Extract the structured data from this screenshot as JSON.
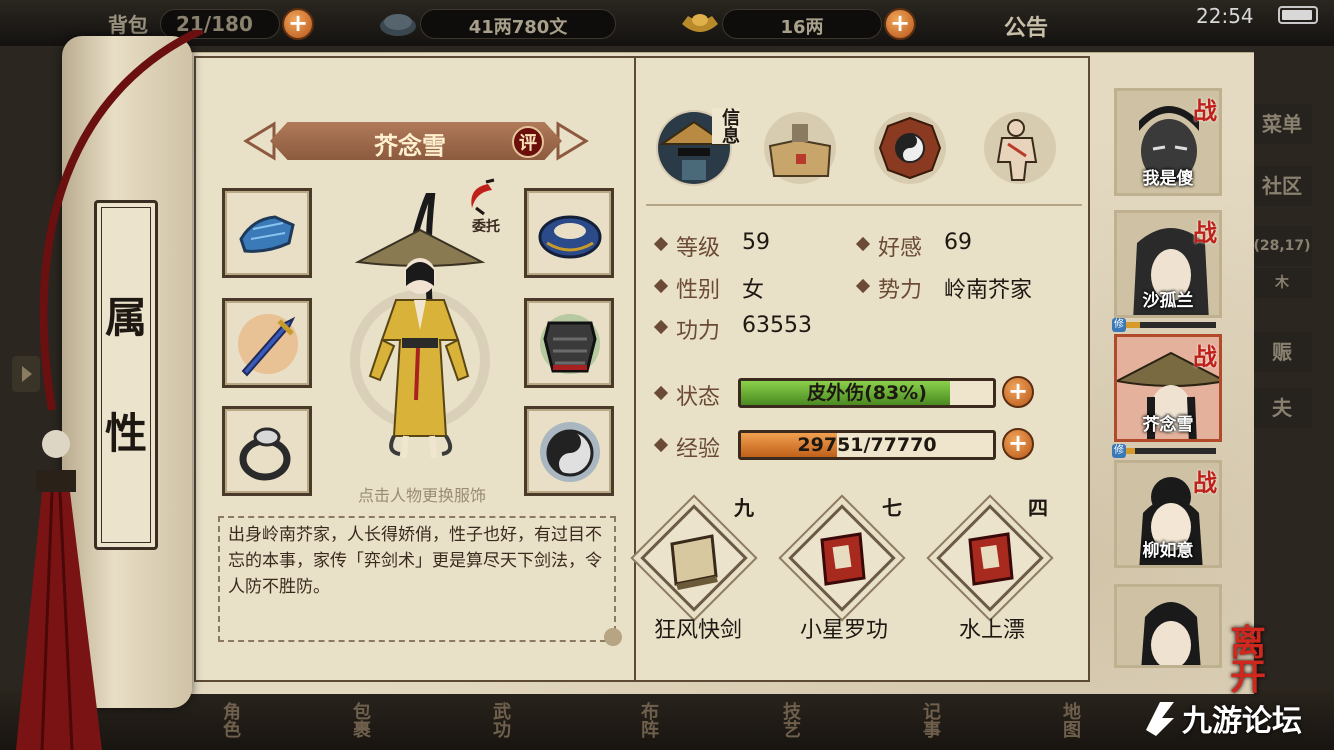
{
  "topbar": {
    "bag_label": "背包",
    "bag_count": "21/180",
    "money": "41两780文",
    "gold": "16两",
    "notice_label": "公告",
    "clock": "22:54"
  },
  "scroll": {
    "title_top": "属",
    "title_bottom": "性"
  },
  "character": {
    "name": "芥念雪",
    "review_badge": "评",
    "commission_label": "委托",
    "hint": "点击人物更换服饰",
    "description": "出身岭南芥家，人长得娇俏，性子也好，有过目不忘的本事，家传「弈剑术」更是算尽天下剑法，令人防不胜防。"
  },
  "equipment": [
    {
      "slot": "gloves",
      "icon": "gauntlet-icon"
    },
    {
      "slot": "collar",
      "icon": "collar-icon"
    },
    {
      "slot": "weapon",
      "icon": "sword-icon"
    },
    {
      "slot": "armor",
      "icon": "armor-icon"
    },
    {
      "slot": "ring",
      "icon": "ring-icon"
    },
    {
      "slot": "amulet",
      "icon": "yinyang-amulet-icon"
    }
  ],
  "tabs": {
    "info_label": "信息",
    "items": [
      "info-tab",
      "bag-tab",
      "bagua-tab",
      "meridian-tab"
    ]
  },
  "stats": {
    "level_label": "等级",
    "level": "59",
    "favor_label": "好感",
    "favor": "69",
    "gender_label": "性别",
    "gender": "女",
    "faction_label": "势力",
    "faction": "岭南芥家",
    "power_label": "功力",
    "power": "63553",
    "status_label": "状态",
    "status_text": "皮外伤(83%)",
    "status_fraction": 0.83,
    "exp_label": "经验",
    "exp_text": "29751/77770",
    "exp_fraction": 0.3826
  },
  "skills": [
    {
      "level": "九",
      "name": "狂风快剑"
    },
    {
      "level": "七",
      "name": "小星罗功"
    },
    {
      "level": "四",
      "name": "水上漂"
    }
  ],
  "roster": [
    {
      "name": "我是傻",
      "badge": "战"
    },
    {
      "name": "沙孤兰",
      "badge": "战",
      "xiu": "修",
      "xiu_fraction": 0.15
    },
    {
      "name": "芥念雪",
      "badge": "战",
      "xiu": "修",
      "xiu_fraction": 0.1
    },
    {
      "name": "柳如意",
      "badge": "战"
    },
    {
      "name": "",
      "badge": ""
    }
  ],
  "side_menu": [
    "菜单",
    "社区",
    "(28,17)",
    "木",
    "赈",
    "夫"
  ],
  "bottom_nav": [
    "角色",
    "包裹",
    "武功",
    "布阵",
    "技艺",
    "记事",
    "地图"
  ],
  "leave_label": "离开",
  "watermark": "九游论坛",
  "colors": {
    "status_bar": "#5aa032",
    "exp_bar": "#d0701e",
    "accent_red": "#c0201a",
    "parchment": "#e4dac2"
  }
}
